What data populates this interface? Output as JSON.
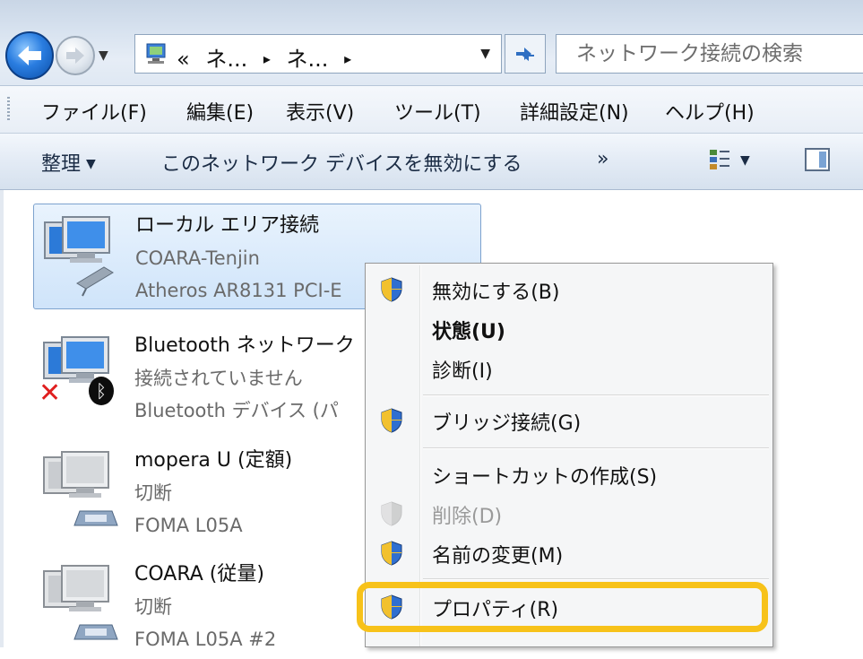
{
  "address": {
    "crumbs": [
      "«",
      "ネ...",
      "▸",
      "ネ...",
      "▸"
    ],
    "search_placeholder": "ネットワーク接続の検索"
  },
  "menu": {
    "file": "ファイル(F)",
    "edit": "編集(E)",
    "view": "表示(V)",
    "tools": "ツール(T)",
    "advanced": "詳細設定(N)",
    "help": "ヘルプ(H)"
  },
  "toolbar": {
    "organize": "整理",
    "disable_device": "このネットワーク デバイスを無効にする",
    "more": "»"
  },
  "connections": [
    {
      "name": "ローカル エリア接続",
      "status": "COARA-Tenjin",
      "device": "Atheros AR8131 PCI-E"
    },
    {
      "name": "Bluetooth ネットワーク",
      "status": "接続されていません",
      "device": "Bluetooth デバイス (パ"
    },
    {
      "name": "mopera U (定額)",
      "status": "切断",
      "device": "FOMA L05A"
    },
    {
      "name": "COARA (従量)",
      "status": "切断",
      "device": "FOMA L05A #2"
    }
  ],
  "context_menu": {
    "items": [
      {
        "label": "無効にする(B)"
      },
      {
        "label": "状態(U)"
      },
      {
        "label": "診断(I)"
      },
      {
        "label": "ブリッジ接続(G)"
      },
      {
        "label": "ショートカットの作成(S)"
      },
      {
        "label": "削除(D)"
      },
      {
        "label": "名前の変更(M)"
      },
      {
        "label": "プロパティ(R)"
      }
    ]
  },
  "colors": {
    "highlight": "#f7c21a",
    "selection": "#cfe4fa",
    "disconnect_x": "#e01f1f"
  }
}
